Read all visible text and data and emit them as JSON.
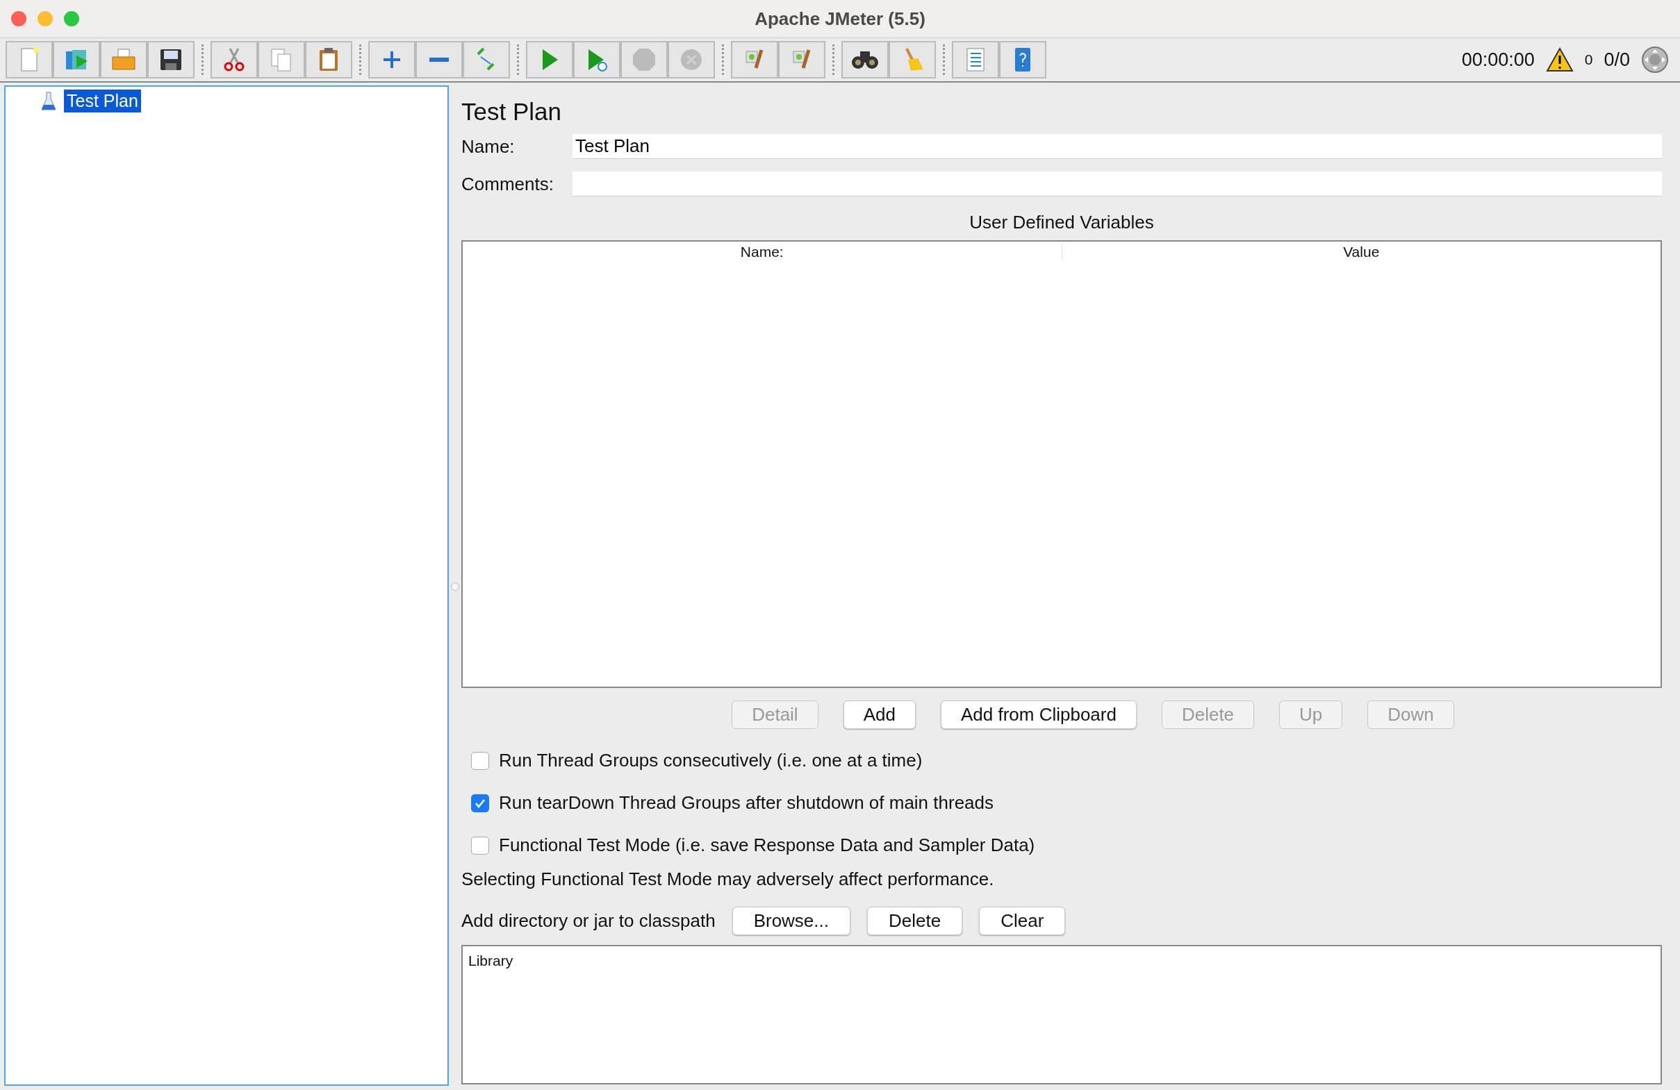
{
  "window": {
    "title": "Apache JMeter (5.5)"
  },
  "toolbar": {
    "groups": [
      [
        {
          "kind": "new",
          "disabled": false
        },
        {
          "kind": "templates",
          "disabled": false
        },
        {
          "kind": "open",
          "disabled": false
        },
        {
          "kind": "save",
          "disabled": false
        }
      ],
      [
        {
          "kind": "cut",
          "disabled": false
        },
        {
          "kind": "copy",
          "disabled": false
        },
        {
          "kind": "paste",
          "disabled": false
        }
      ],
      [
        {
          "kind": "expand",
          "disabled": false
        },
        {
          "kind": "collapse",
          "disabled": false
        },
        {
          "kind": "toggle",
          "disabled": false
        }
      ],
      [
        {
          "kind": "start",
          "disabled": false
        },
        {
          "kind": "start-no-timers",
          "disabled": false
        },
        {
          "kind": "stop",
          "disabled": true
        },
        {
          "kind": "shutdown",
          "disabled": true
        }
      ],
      [
        {
          "kind": "clear",
          "disabled": false
        },
        {
          "kind": "clear-all",
          "disabled": false
        }
      ],
      [
        {
          "kind": "search",
          "disabled": false
        },
        {
          "kind": "reset-search",
          "disabled": false
        }
      ],
      [
        {
          "kind": "function-helper",
          "disabled": false
        },
        {
          "kind": "help",
          "disabled": false
        }
      ]
    ],
    "timer": "00:00:00",
    "warnings": "0",
    "threads": "0/0"
  },
  "tree": {
    "items": [
      {
        "label": "Test Plan",
        "selected": true
      }
    ]
  },
  "panel": {
    "title": "Test Plan",
    "name_label": "Name:",
    "name_value": "Test Plan",
    "comments_label": "Comments:",
    "variables": {
      "title": "User Defined Variables",
      "columns": [
        "Name:",
        "Value"
      ]
    },
    "table_buttons": [
      {
        "label": "Detail",
        "disabled": true
      },
      {
        "label": "Add",
        "disabled": false
      },
      {
        "label": "Add from Clipboard",
        "disabled": false
      },
      {
        "label": "Delete",
        "disabled": true
      },
      {
        "label": "Up",
        "disabled": true
      },
      {
        "label": "Down",
        "disabled": true
      }
    ],
    "options": [
      {
        "label": "Run Thread Groups consecutively (i.e. one at a time)",
        "checked": false
      },
      {
        "label": "Run tearDown Thread Groups after shutdown of main threads",
        "checked": true
      },
      {
        "label": "Functional Test Mode (i.e. save Response Data and Sampler Data)",
        "checked": false
      }
    ],
    "note": "Selecting Functional Test Mode may adversely affect performance.",
    "classpath_label": "Add directory or jar to classpath",
    "classpath_buttons": [
      {
        "label": "Browse...",
        "disabled": false
      },
      {
        "label": "Delete",
        "disabled": false
      },
      {
        "label": "Clear",
        "disabled": false
      }
    ],
    "library": {
      "columns": [
        "Library"
      ]
    }
  }
}
